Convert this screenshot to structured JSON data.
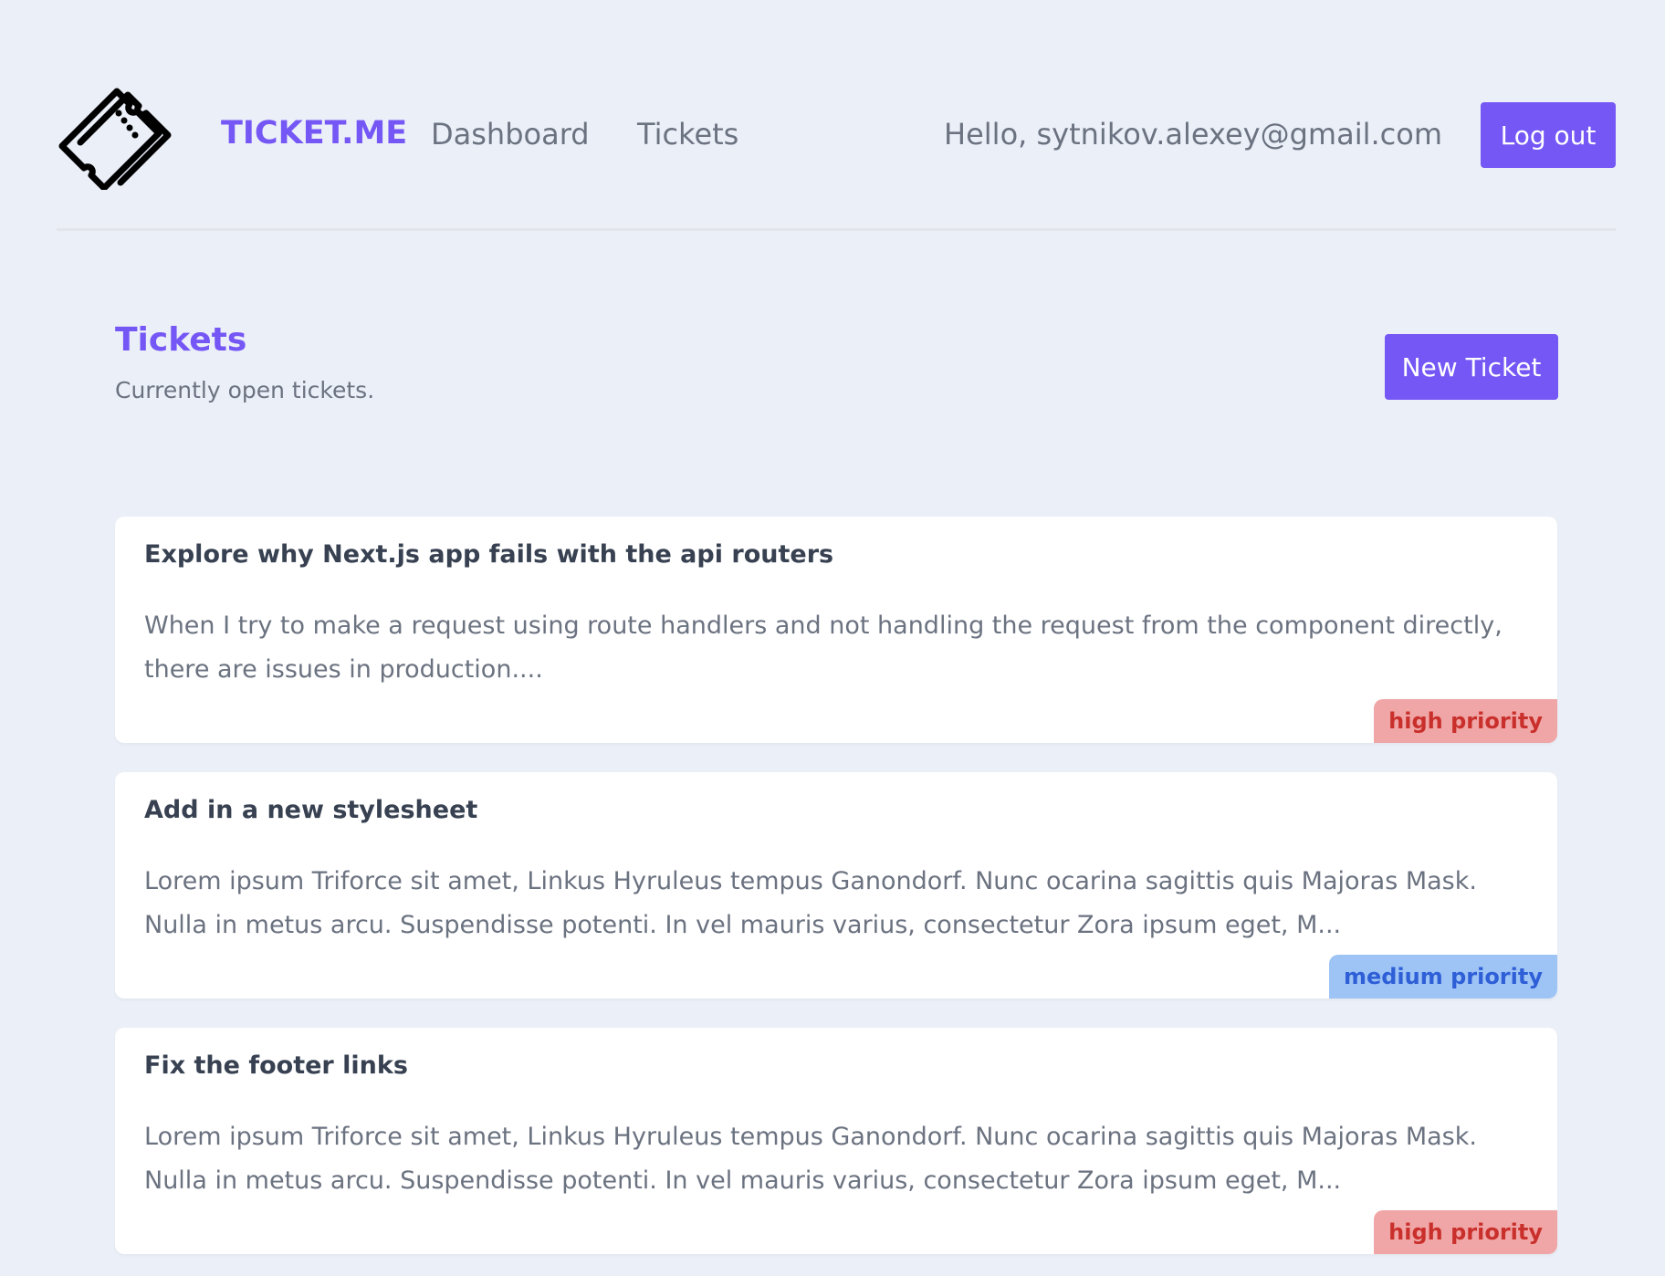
{
  "nav": {
    "brand": "TICKET.ME",
    "links": [
      "Dashboard",
      "Tickets"
    ],
    "greeting": "Hello, sytnikov.alexey@gmail.com",
    "logout_label": "Log out",
    "logo_icon": "ticket-icon"
  },
  "page": {
    "title": "Tickets",
    "subtitle": "Currently open tickets.",
    "new_ticket_label": "New Ticket"
  },
  "tickets": [
    {
      "title": "Explore why Next.js app fails with the api routers",
      "body": "When I try to make a request using route handlers and not handling the request from the component directly, there are issues in production....",
      "priority": "high priority",
      "priority_level": "high"
    },
    {
      "title": "Add in a new stylesheet",
      "body": "Lorem ipsum Triforce sit amet, Linkus Hyruleus tempus Ganondorf. Nunc ocarina sagittis quis Majoras Mask. Nulla in metus arcu. Suspendisse potenti. In vel mauris varius, consectetur Zora ipsum eget, M...",
      "priority": "medium priority",
      "priority_level": "medium"
    },
    {
      "title": "Fix the footer links",
      "body": "Lorem ipsum Triforce sit amet, Linkus Hyruleus tempus Ganondorf. Nunc ocarina sagittis quis Majoras Mask. Nulla in metus arcu. Suspendisse potenti. In vel mauris varius, consectetur Zora ipsum eget, M...",
      "priority": "high priority",
      "priority_level": "high"
    }
  ],
  "colors": {
    "accent": "#7557f5",
    "background": "#ebeff8",
    "high_bg": "#f0a6a6",
    "high_text": "#c9302c",
    "medium_bg": "#9ec4f5",
    "medium_text": "#2f5fd7"
  }
}
